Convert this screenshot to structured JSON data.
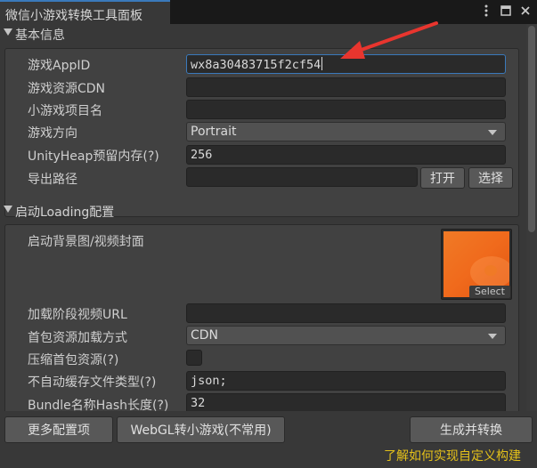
{
  "window": {
    "tab_title": "微信小游戏转换工具面板",
    "menu_icon": "kebab-menu-icon",
    "maximize_icon": "maximize-icon",
    "close_icon": "close-icon"
  },
  "basic_info": {
    "title": "基本信息",
    "fields": {
      "appid_label": "游戏AppID",
      "appid_value": "wx8a30483715f2cf54",
      "cdn_label": "游戏资源CDN",
      "cdn_value": "",
      "project_name_label": "小游戏项目名",
      "project_name_value": "",
      "orientation_label": "游戏方向",
      "orientation_value": "Portrait",
      "heap_label": "UnityHeap预留内存(?)",
      "heap_value": "256",
      "export_path_label": "导出路径",
      "export_path_value": "",
      "open_button": "打开",
      "select_button": "选择"
    }
  },
  "loading_config": {
    "title": "启动Loading配置",
    "cover_label": "启动背景图/视频封面",
    "texture_select": "Select",
    "video_url_label": "加载阶段视频URL",
    "video_url_value": "",
    "load_method_label": "首包资源加载方式",
    "load_method_value": "CDN",
    "compress_label": "压缩首包资源(?)",
    "compress_checked": false,
    "no_cache_label": "不自动缓存文件类型(?)",
    "no_cache_value": "json;",
    "hash_len_label": "Bundle名称Hash长度(?)",
    "hash_len_value": "32"
  },
  "footer": {
    "more_config_button": "更多配置项",
    "webgl_button": "WebGL转小游戏(不常用)",
    "build_button": "生成并转换",
    "custom_build_link": "了解如何实现自定义构建"
  },
  "colors": {
    "accent": "#3a79bb",
    "link": "#e3c01a",
    "annotation_arrow": "#e8352e",
    "panel": "#383838"
  }
}
